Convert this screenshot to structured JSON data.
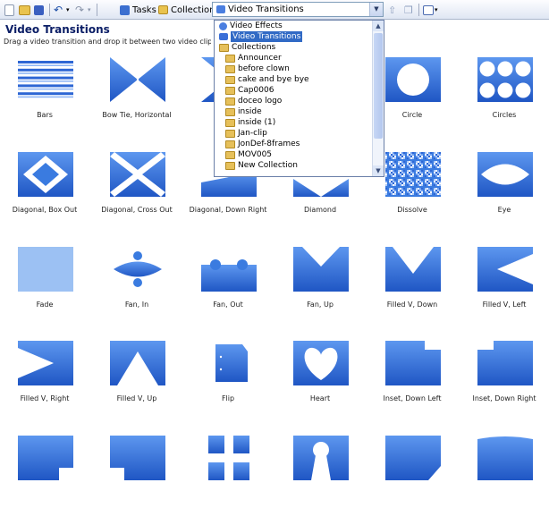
{
  "toolbar": {
    "tasks_label": "Tasks",
    "collections_label": "Collections",
    "dropdown_value": "Video Transitions"
  },
  "header": {
    "title": "Video Transitions",
    "instruction": "Drag a video transition and drop it between two video clips o"
  },
  "dropdown": {
    "items": [
      {
        "label": "Video Effects",
        "type": "effects"
      },
      {
        "label": "Video Transitions",
        "type": "transitions",
        "selected": true
      },
      {
        "label": "Collections",
        "type": "folder"
      },
      {
        "label": "Announcer",
        "type": "folder",
        "indent": true
      },
      {
        "label": "before clown",
        "type": "folder",
        "indent": true
      },
      {
        "label": "cake and bye bye",
        "type": "folder",
        "indent": true
      },
      {
        "label": "Cap0006",
        "type": "folder",
        "indent": true
      },
      {
        "label": "doceo logo",
        "type": "folder",
        "indent": true
      },
      {
        "label": "inside",
        "type": "folder",
        "indent": true
      },
      {
        "label": "inside (1)",
        "type": "folder",
        "indent": true
      },
      {
        "label": "Jan-clip",
        "type": "folder",
        "indent": true
      },
      {
        "label": "JonDef-8frames",
        "type": "folder",
        "indent": true
      },
      {
        "label": "MOV005",
        "type": "folder",
        "indent": true
      },
      {
        "label": "New Collection",
        "type": "folder",
        "indent": true
      }
    ]
  },
  "transitions": [
    {
      "label": "Bars",
      "icon": "bars-icon"
    },
    {
      "label": "Bow Tie, Horizontal",
      "icon": "bow-tie-horizontal-icon"
    },
    {
      "label": "Bo",
      "icon": "bow-tie-vertical-icon"
    },
    {
      "label": "",
      "icon": "hidden-transition-icon"
    },
    {
      "label": "Circle",
      "icon": "circle-icon"
    },
    {
      "label": "Circles",
      "icon": "circles-icon"
    },
    {
      "label": "Diagonal, Box Out",
      "icon": "diagonal-box-out-icon"
    },
    {
      "label": "Diagonal, Cross Out",
      "icon": "diagonal-cross-out-icon"
    },
    {
      "label": "Diagonal, Down Right",
      "icon": "diagonal-down-right-icon"
    },
    {
      "label": "Diamond",
      "icon": "diamond-icon"
    },
    {
      "label": "Dissolve",
      "icon": "dissolve-icon"
    },
    {
      "label": "Eye",
      "icon": "eye-icon"
    },
    {
      "label": "Fade",
      "icon": "fade-icon"
    },
    {
      "label": "Fan, In",
      "icon": "fan-in-icon"
    },
    {
      "label": "Fan, Out",
      "icon": "fan-out-icon"
    },
    {
      "label": "Fan, Up",
      "icon": "fan-up-icon"
    },
    {
      "label": "Filled V, Down",
      "icon": "filled-v-down-icon"
    },
    {
      "label": "Filled V, Left",
      "icon": "filled-v-left-icon"
    },
    {
      "label": "Filled V, Right",
      "icon": "filled-v-right-icon"
    },
    {
      "label": "Filled V, Up",
      "icon": "filled-v-up-icon"
    },
    {
      "label": "Flip",
      "icon": "flip-icon"
    },
    {
      "label": "Heart",
      "icon": "heart-icon"
    },
    {
      "label": "Inset, Down Left",
      "icon": "inset-down-left-icon"
    },
    {
      "label": "Inset, Down Right",
      "icon": "inset-down-right-icon"
    },
    {
      "label": "",
      "icon": "inset-variant-1-icon"
    },
    {
      "label": "",
      "icon": "inset-variant-2-icon"
    },
    {
      "label": "",
      "icon": "split-icon"
    },
    {
      "label": "",
      "icon": "keyhole-icon"
    },
    {
      "label": "",
      "icon": "inset-variant-3-icon"
    },
    {
      "label": "",
      "icon": "inset-variant-4-icon"
    }
  ],
  "colors": {
    "accent": "#3a7be0",
    "dark": "#1f56c4",
    "title": "#0b1e66"
  }
}
